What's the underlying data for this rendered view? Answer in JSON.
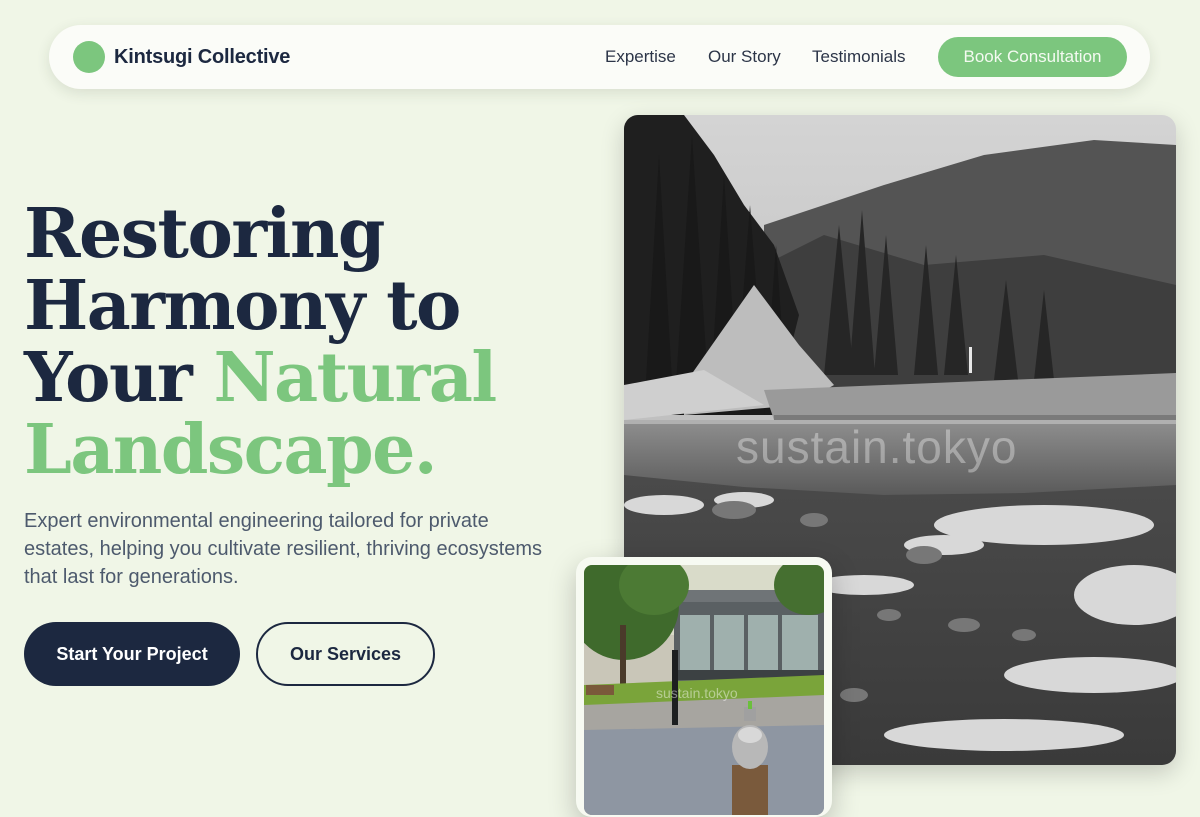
{
  "nav": {
    "brand": "Kintsugi Collective",
    "links": [
      "Expertise",
      "Our Story",
      "Testimonials"
    ],
    "cta": "Book Consultation"
  },
  "hero": {
    "title_line1": "Restoring",
    "title_line2": "Harmony to",
    "title_line3_dark": "Your ",
    "title_line3_accent": "Natural",
    "title_line4_accent": "Landscape.",
    "subtitle": "Expert environmental engineering tailored for private estates, helping you cultivate resilient, thriving ecosystems that last for generations.",
    "primary_button": "Start Your Project",
    "secondary_button": "Our Services"
  },
  "images": {
    "main_watermark": "sustain.tokyo",
    "inset_watermark": "sustain.tokyo"
  },
  "colors": {
    "background": "#f0f6e7",
    "brand_green": "#7cc67e",
    "navy": "#1c2840"
  }
}
